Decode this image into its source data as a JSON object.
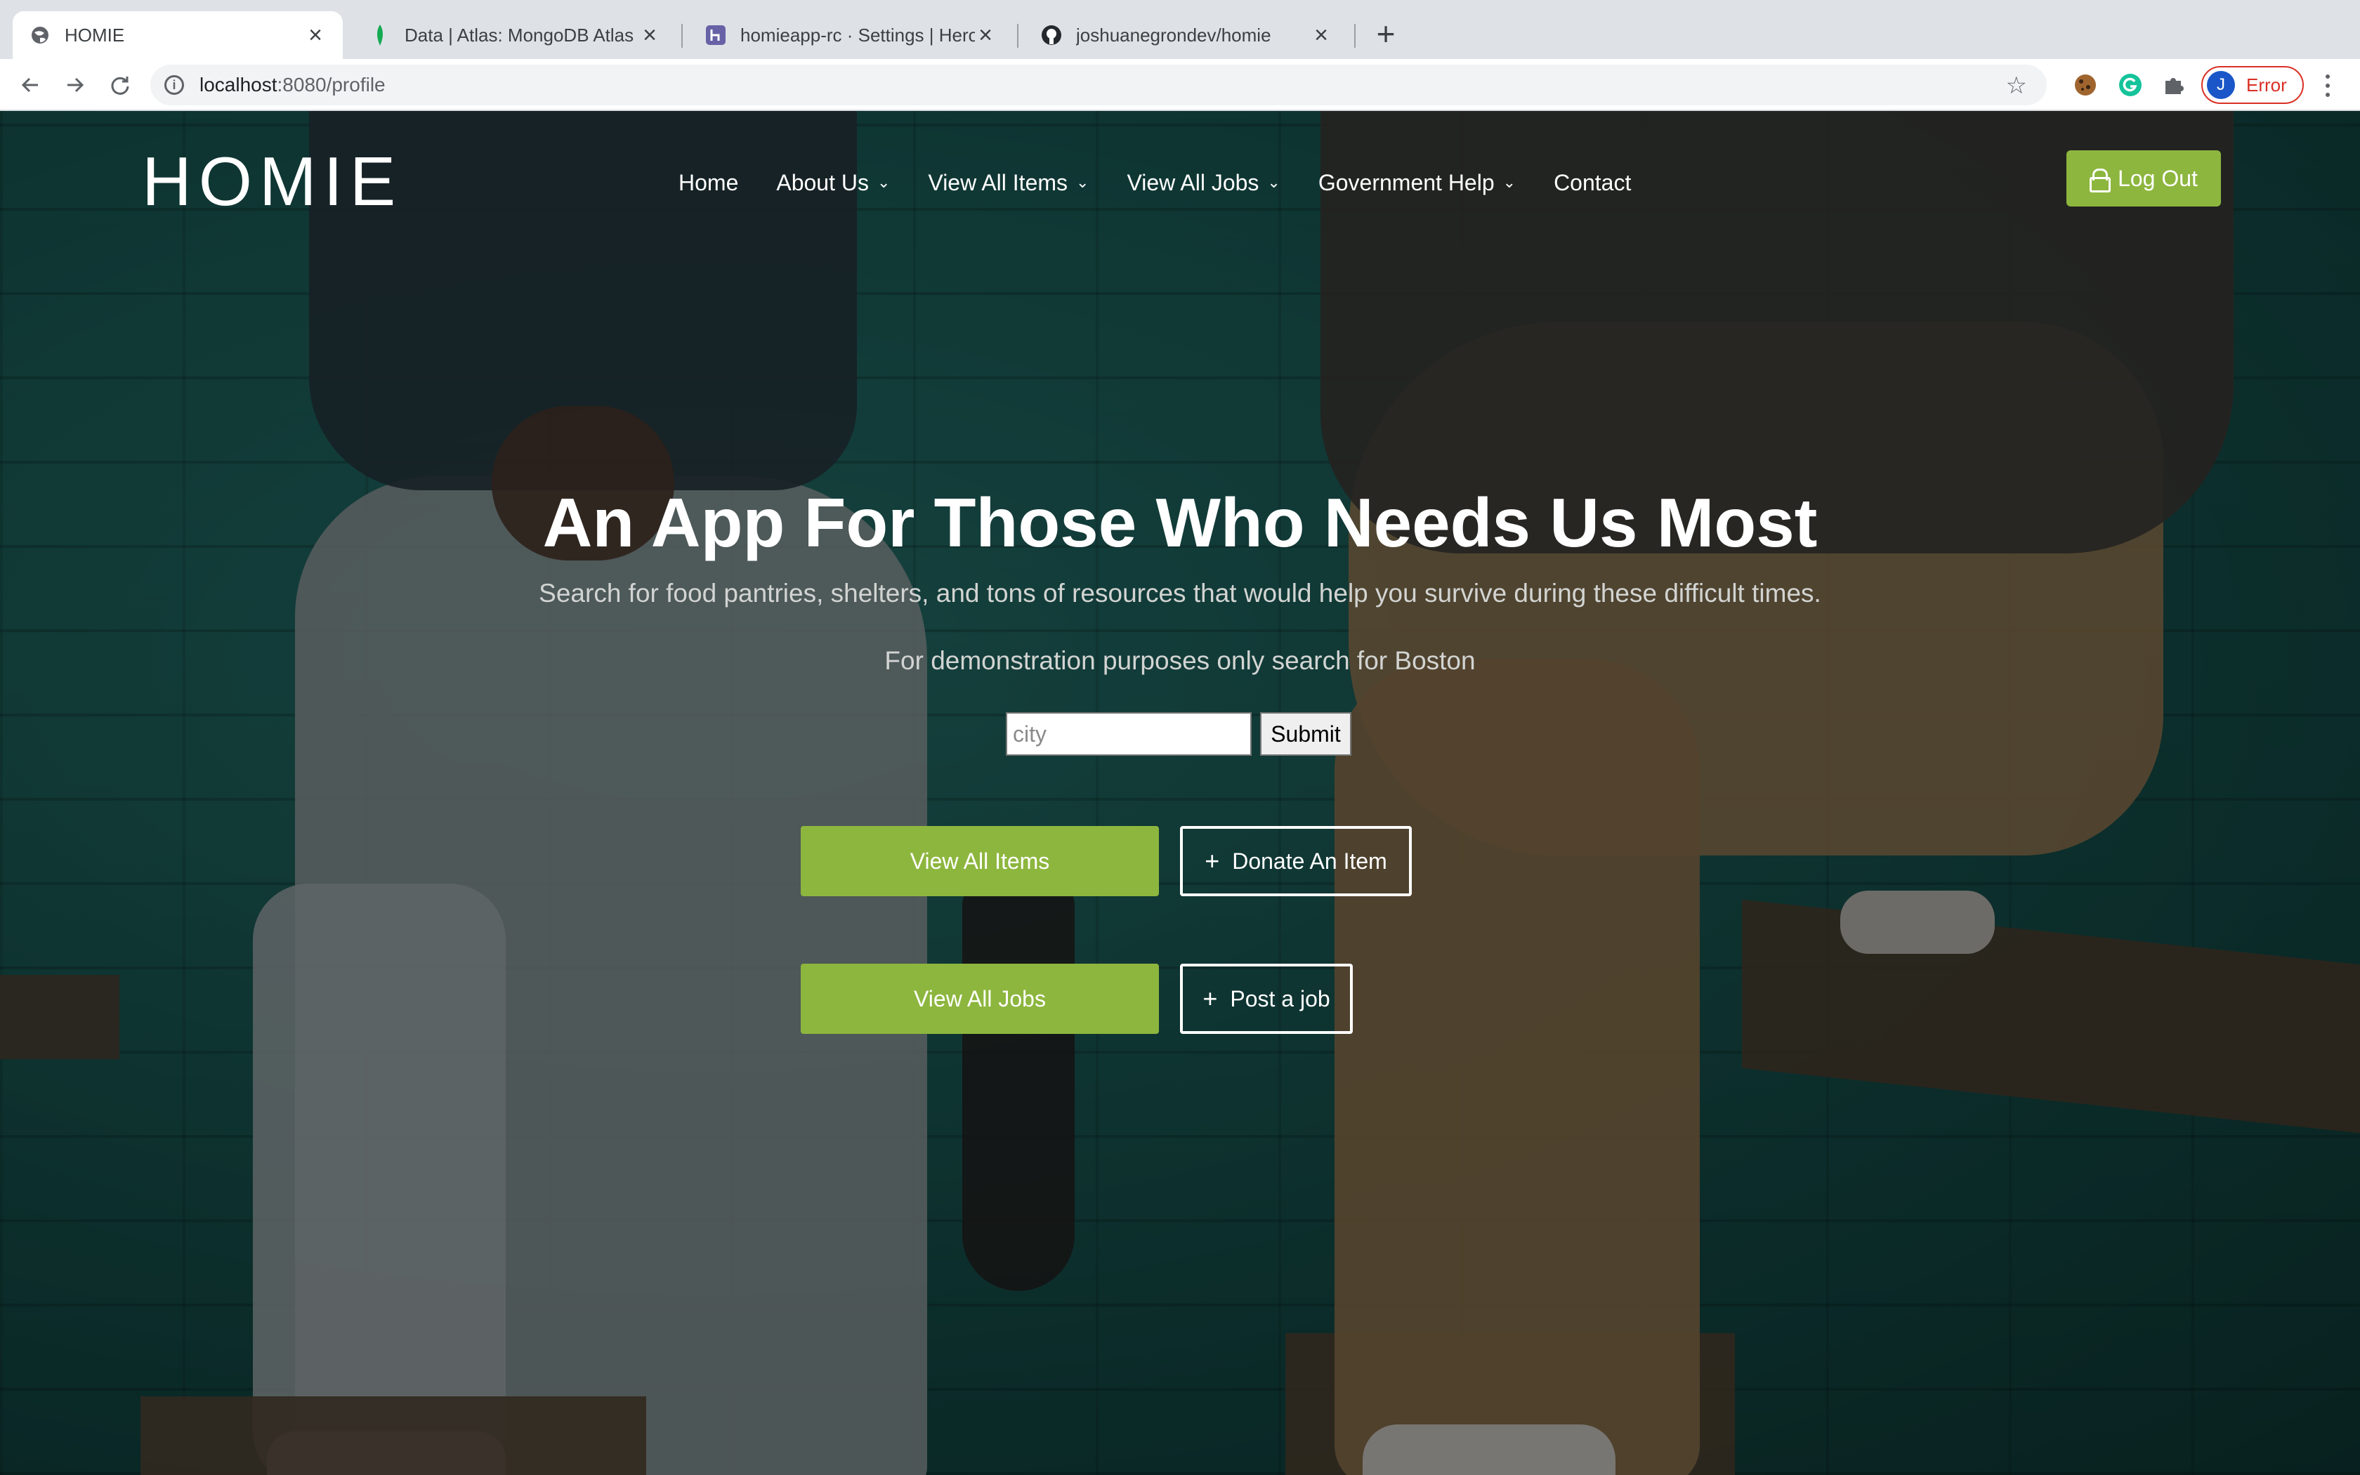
{
  "browser": {
    "tabs": [
      {
        "title": "HOMIE",
        "favicon": "globe-icon",
        "active": true
      },
      {
        "title": "Data | Atlas: MongoDB Atlas",
        "favicon": "mongodb-leaf-icon",
        "active": false
      },
      {
        "title": "homieapp-rc · Settings | Herok",
        "favicon": "heroku-icon",
        "active": false
      },
      {
        "title": "joshuanegrondev/homie",
        "favicon": "github-icon",
        "active": false
      }
    ],
    "url_host": "localhost",
    "url_path": ":8080/profile",
    "profile_initial": "J",
    "profile_status": "Error"
  },
  "site": {
    "logo": "HOMIE",
    "nav": [
      {
        "label": "Home",
        "dropdown": false
      },
      {
        "label": "About Us",
        "dropdown": true
      },
      {
        "label": "View All Items",
        "dropdown": true
      },
      {
        "label": "View All Jobs",
        "dropdown": true
      },
      {
        "label": "Government Help",
        "dropdown": true
      },
      {
        "label": "Contact",
        "dropdown": false
      }
    ],
    "logout_label": "Log Out",
    "accent_color": "#8db63e"
  },
  "hero": {
    "title": "An App For Those Who Needs Us Most",
    "subtitle": "Search for food pantries, shelters, and tons of resources that would help you survive during these difficult times.",
    "demo_note": "For demonstration purposes only search for Boston",
    "search_placeholder": "city",
    "submit_label": "Submit",
    "view_items_label": "View All Items",
    "donate_label": "Donate An Item",
    "view_jobs_label": "View All Jobs",
    "post_job_label": "Post a job"
  }
}
